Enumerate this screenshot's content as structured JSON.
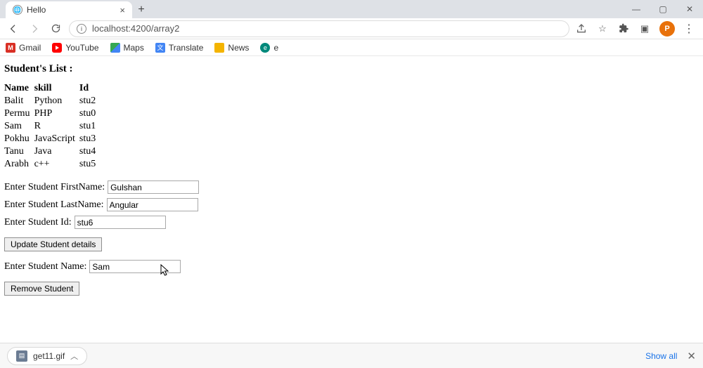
{
  "browser": {
    "tab": {
      "title": "Hello"
    },
    "url": "localhost:4200/array2",
    "bookmarks": [
      {
        "label": "Gmail"
      },
      {
        "label": "YouTube"
      },
      {
        "label": "Maps"
      },
      {
        "label": "Translate"
      },
      {
        "label": "News"
      },
      {
        "label": "e"
      }
    ],
    "avatar_initial": "P"
  },
  "page": {
    "heading": "Student's List :",
    "table": {
      "headers": [
        "Name",
        "skill",
        "Id"
      ],
      "rows": [
        {
          "name": "Balit",
          "skill": "Python",
          "id": "stu2"
        },
        {
          "name": "Permu",
          "skill": "PHP",
          "id": "stu0"
        },
        {
          "name": "Sam",
          "skill": "R",
          "id": "stu1"
        },
        {
          "name": "Pokhu",
          "skill": "JavaScript",
          "id": "stu3"
        },
        {
          "name": "Tanu",
          "skill": "Java",
          "id": "stu4"
        },
        {
          "name": "Arabh",
          "skill": "c++",
          "id": "stu5"
        }
      ]
    },
    "form": {
      "firstname_label": "Enter Student FirstName:",
      "firstname_value": "Gulshan",
      "lastname_label": "Enter Student LastName:",
      "lastname_value": "Angular",
      "id_label": "Enter Student Id:",
      "id_value": "stu6",
      "update_btn": "Update Student details",
      "studentname_label": "Enter Student Name:",
      "studentname_value": "Sam",
      "remove_btn": "Remove Student"
    }
  },
  "downloads": {
    "item_name": "get11.gif",
    "show_all": "Show all"
  }
}
